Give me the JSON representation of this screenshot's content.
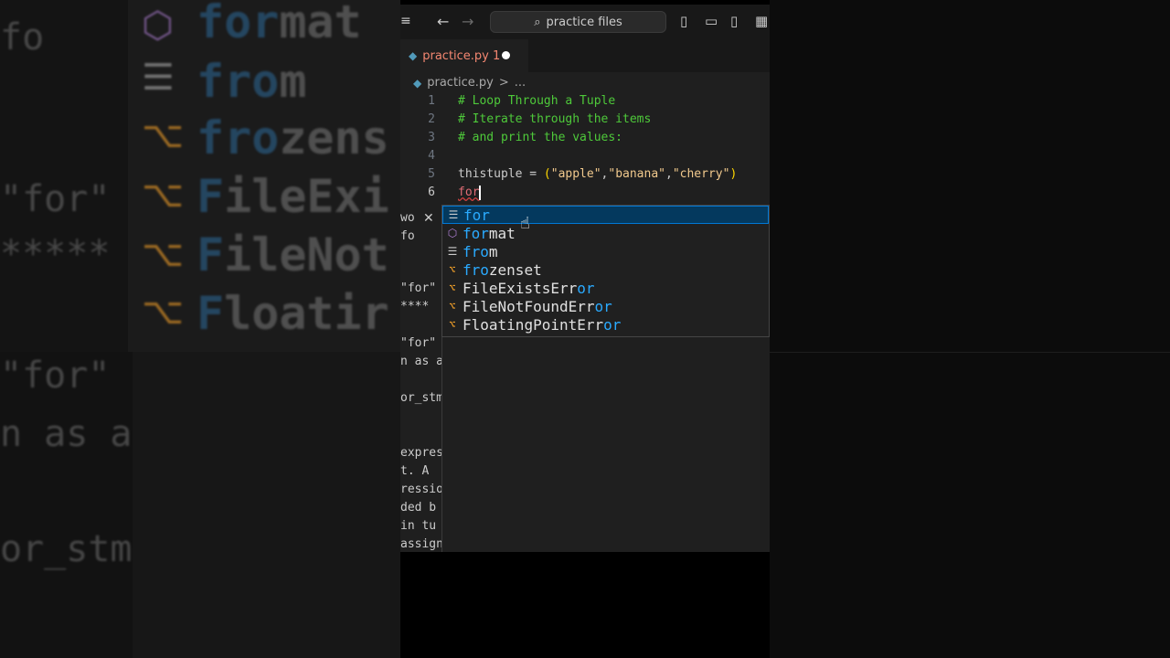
{
  "background": {
    "left_list": [
      {
        "prefix": "for",
        "rest": "mat",
        "icon": "⬡"
      },
      {
        "prefix": "fro",
        "rest": "m",
        "icon": "☰"
      },
      {
        "prefix": "fro",
        "rest": "zens",
        "icon": "⌥"
      },
      {
        "prefix": "F",
        "rest": "ileExi",
        "icon": "⌥"
      },
      {
        "prefix": "F",
        "rest": "ileNot",
        "icon": "⌥"
      },
      {
        "prefix": "F",
        "rest": "loatir",
        "icon": "⌥"
      }
    ],
    "left_text": [
      "fo",
      "\"for\"",
      "*****",
      "\"for\"",
      "n as a",
      "or_stm"
    ]
  },
  "titlebar": {
    "menu_icon": "≡",
    "back_icon": "←",
    "forward_icon": "→",
    "search_icon": "⌕",
    "search_label": "practice files",
    "layout_icons": [
      "▯",
      "▭",
      "▯",
      "▦"
    ]
  },
  "tab": {
    "name": "practice.py",
    "problems": "1"
  },
  "breadcrumb": {
    "file": "practice.py",
    "separator": ">",
    "more": "..."
  },
  "code_lines": [
    {
      "num": "1",
      "text": "# Loop Through a Tuple"
    },
    {
      "num": "2",
      "text": "# Iterate through the items"
    },
    {
      "num": "3",
      "text": "# and print the values:"
    },
    {
      "num": "4",
      "text": ""
    },
    {
      "num": "5",
      "var": "thistuple = ",
      "open": "(",
      "s1": "\"apple\"",
      "s2": "\"banana\"",
      "s3": "\"cherry\"",
      "close": ")"
    },
    {
      "num": "6",
      "text": "for"
    }
  ],
  "hover_panel": {
    "lines": [
      "wo",
      "fo",
      "\"for\"",
      "****",
      "\"for\"",
      "n as a",
      "or_stm",
      "expres",
      "t.  A",
      "ressio",
      "ded b",
      "in tu",
      "assign"
    ],
    "close_icon": "✕"
  },
  "suggestions": [
    {
      "match": "for",
      "rest": "",
      "kind": "keyword",
      "icon": "☰"
    },
    {
      "match": "for",
      "rest": "mat",
      "kind": "function",
      "icon": "⬡"
    },
    {
      "match": "fro",
      "rest": "m",
      "kind": "keyword",
      "icon": "☰"
    },
    {
      "match": "fro",
      "rest": "zenset",
      "kind": "class",
      "icon": "⌥"
    },
    {
      "match": "F",
      "rest": "ileExistsErr",
      "tail": "or",
      "kind": "class",
      "icon": "⌥"
    },
    {
      "match": "F",
      "rest": "ileNotFoundErr",
      "tail": "or",
      "kind": "class",
      "icon": "⌥"
    },
    {
      "match": "F",
      "rest": "loatingPointErr",
      "tail": "or",
      "kind": "class",
      "icon": "⌥"
    }
  ],
  "pointer_icon": "☝",
  "colors": {
    "accent": "#0078d4",
    "match": "#2aaaff",
    "comment": "#4ec93a",
    "string": "#f1c98d",
    "tab_modified": "#f48771"
  }
}
